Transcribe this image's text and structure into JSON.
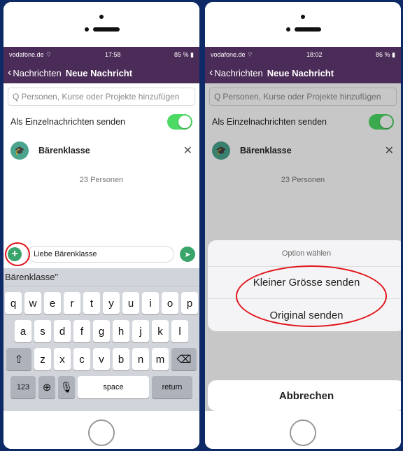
{
  "left": {
    "status": {
      "carrier": "vodafone.de",
      "time": "17:58",
      "battery": "85 %"
    },
    "nav": {
      "back": "Nachrichten",
      "title": "Neue Nachricht"
    },
    "search_placeholder": "Personen, Kurse oder Projekte hinzufügen",
    "toggle_label": "Als Einzelnachrichten senden",
    "group": {
      "name": "Bärenklasse",
      "count": "23 Personen"
    },
    "message": "Liebe Bärenklasse",
    "suggestion": "Bärenklasse\"",
    "keyboard": {
      "row1": [
        "q",
        "w",
        "e",
        "r",
        "t",
        "y",
        "u",
        "i",
        "o",
        "p"
      ],
      "row2": [
        "a",
        "s",
        "d",
        "f",
        "g",
        "h",
        "j",
        "k",
        "l"
      ],
      "row3": [
        "z",
        "x",
        "c",
        "v",
        "b",
        "n",
        "m"
      ],
      "num": "123",
      "space": "space",
      "return": "return"
    }
  },
  "right": {
    "status": {
      "carrier": "vodafone.de",
      "time": "18:02",
      "battery": "86 %"
    },
    "nav": {
      "back": "Nachrichten",
      "title": "Neue Nachricht"
    },
    "search_placeholder": "Personen, Kurse oder Projekte hinzufügen",
    "toggle_label": "Als Einzelnachrichten senden",
    "group": {
      "name": "Bärenklasse",
      "count": "23 Personen"
    },
    "sheet": {
      "title": "Option wählen",
      "option1": "Kleiner Grösse senden",
      "option2": "Original senden",
      "cancel": "Abbrechen"
    }
  },
  "colors": {
    "header": "#4b2b57",
    "accent": "#3aa56a",
    "highlight": "#e0141a"
  }
}
